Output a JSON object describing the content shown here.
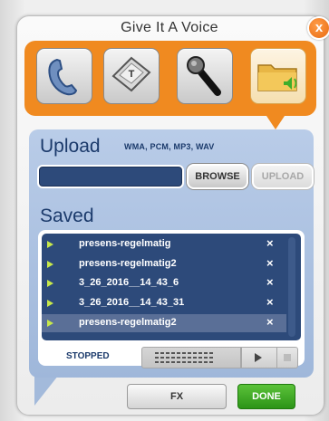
{
  "dialog": {
    "title": "Give It A Voice",
    "close_glyph": "x"
  },
  "modes": [
    {
      "name": "phone",
      "icon": "phone-icon",
      "active": false
    },
    {
      "name": "text-to-speech",
      "icon": "keyboard-key-icon",
      "key_letter": "T",
      "active": false
    },
    {
      "name": "microphone",
      "icon": "microphone-icon",
      "active": false
    },
    {
      "name": "upload",
      "icon": "folder-audio-icon",
      "active": true
    }
  ],
  "upload": {
    "heading": "Upload",
    "formats": "WMA, PCM, MP3, WAV",
    "file_value": "",
    "browse_label": "BROWSE",
    "upload_label": "UPLOAD"
  },
  "saved": {
    "heading": "Saved",
    "items": [
      {
        "name": "presens-regelmatig",
        "selected": false
      },
      {
        "name": "presens-regelmatig2",
        "selected": false
      },
      {
        "name": "3_26_2016__14_43_6",
        "selected": false
      },
      {
        "name": "3_26_2016__14_43_31",
        "selected": false
      },
      {
        "name": "presens-regelmatig2",
        "selected": true
      }
    ],
    "delete_glyph": "×"
  },
  "player": {
    "status": "STOPPED"
  },
  "footer": {
    "fx_label": "FX",
    "done_label": "DONE"
  },
  "colors": {
    "accent_orange": "#f08a20",
    "panel_blue": "#a9bfdf",
    "list_navy": "#2d4a7a",
    "done_green": "#3aa520",
    "play_arrow_green": "#c8e84a"
  }
}
